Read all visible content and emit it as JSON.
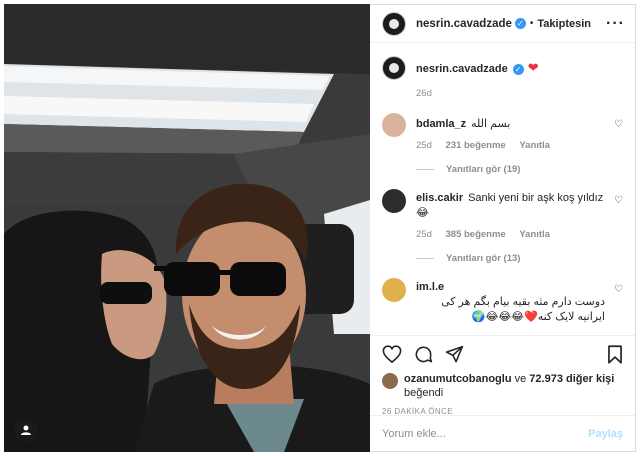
{
  "post": {
    "author": "nesrin.cavadzade",
    "follow_label": "Takiptesin",
    "more_icon": "ellipsis-icon",
    "caption_icon": "red-heart-emoji",
    "caption_time": "26d"
  },
  "comments": [
    {
      "username": "bdamla_z",
      "text": "بسم الله",
      "time": "25d",
      "likes": "231 beğenme",
      "reply_label": "Yanıtla",
      "view_replies": "Yanıtları gör (19)"
    },
    {
      "username": "elis.cakir",
      "text": "Sanki yeni bir aşk koş yıldız😂",
      "time": "25d",
      "likes": "385 beğenme",
      "reply_label": "Yanıtla",
      "view_replies": "Yanıtları gör (13)"
    },
    {
      "username": "im.l.e",
      "text": "دوست دارم مثه بقیه بیام بگم هر کی ایرانیه لایک کنه❤️😂😂😂🌍"
    }
  ],
  "likes": {
    "first_liker": "ozanumutcobanoglu",
    "joiner": "ve",
    "others": "72.973 diğer kişi",
    "suffix": "beğendi"
  },
  "timestamp": "26 DAKİKA ÖNCE",
  "add_comment": {
    "placeholder": "Yorum ekle...",
    "post_label": "Paylaş"
  },
  "colors": {
    "verified": "#3897f0",
    "muted_text": "#8e8e8e",
    "post_button_disabled": "#b2dffc"
  }
}
